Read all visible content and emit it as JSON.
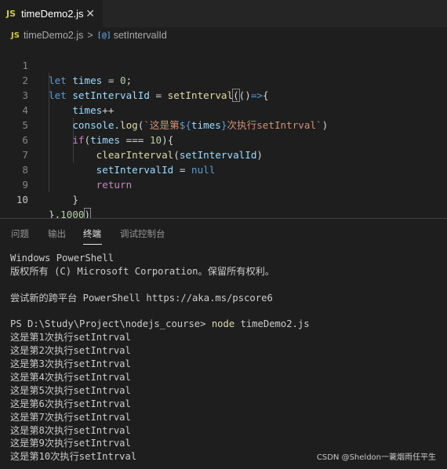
{
  "tab": {
    "icon": "JS",
    "title": "timeDemo2.js",
    "close": "✕"
  },
  "breadcrumb": {
    "icon": "JS",
    "file": "timeDemo2.js",
    "separator": ">",
    "symbol_icon": "[@]",
    "symbol": "setIntervalId"
  },
  "editor": {
    "line_numbers": [
      "1",
      "2",
      "3",
      "4",
      "5",
      "6",
      "7",
      "8",
      "9",
      "10"
    ],
    "l1": {
      "kw": "let",
      "var": "times",
      "eq": " = ",
      "num": "0",
      "end": ";"
    },
    "l2": {
      "kw": "let",
      "var": "setIntervalId",
      "eq": " = ",
      "fn": "setInterval",
      "p1": "(",
      "p2": "()",
      "arrow": "=>",
      "brace": "{"
    },
    "l3": {
      "var": "times",
      "op": "++"
    },
    "l4": {
      "obj": "console",
      "dot": ".",
      "fn": "log",
      "p1": "(",
      "s1": "`这是第",
      "d1": "${",
      "var": "times",
      "d2": "}",
      "s2": "次执行setIntrval`",
      "p2": ")"
    },
    "l5": {
      "kw": "if",
      "p1": "(",
      "var": "times",
      "op": " === ",
      "num": "10",
      "p2": "){"
    },
    "l6": {
      "fn": "clearInterval",
      "p1": "(",
      "var": "setIntervalId",
      "p2": ")"
    },
    "l7": {
      "var": "setIntervalId",
      "eq": " = ",
      "kw": "null"
    },
    "l8": {
      "kw": "return"
    },
    "l9": {
      "brace": "}"
    },
    "l10": {
      "pre": "},",
      "num": "1000",
      "p": ")"
    }
  },
  "panel": {
    "tabs": [
      "问题",
      "输出",
      "终端",
      "调试控制台"
    ],
    "active_tab": "终端"
  },
  "terminal": {
    "l1": "Windows PowerShell",
    "l2": "版权所有 (C) Microsoft Corporation。保留所有权利。",
    "l3": "",
    "l4": "尝试新的跨平台 PowerShell https://aka.ms/pscore6",
    "l5": "",
    "prompt": "PS D:\\Study\\Project\\nodejs_course> ",
    "cmd": "node",
    "arg": " timeDemo2.js",
    "outputs": [
      "这是第1次执行setIntrval",
      "这是第2次执行setIntrval",
      "这是第3次执行setIntrval",
      "这是第4次执行setIntrval",
      "这是第5次执行setIntrval",
      "这是第6次执行setIntrval",
      "这是第7次执行setIntrval",
      "这是第8次执行setIntrval",
      "这是第9次执行setIntrval",
      "这是第10次执行setIntrval"
    ]
  },
  "watermark": "CSDN @Sheldon一蓑烟雨任平生"
}
